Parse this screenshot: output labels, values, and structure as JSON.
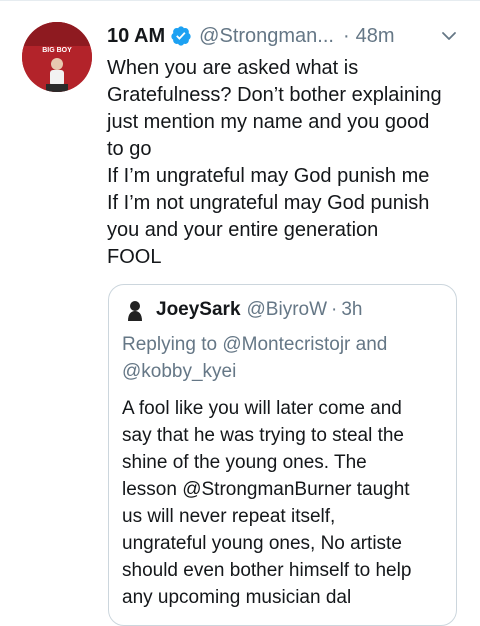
{
  "tweet": {
    "display_name": "10 AM",
    "handle": "@Strongman...",
    "dot": "·",
    "time": "48m",
    "avatar_text": "BIG BOY",
    "lines": [
      "When you are asked what is",
      "Gratefulness? Don’t bother explaining",
      "just mention my name and you good",
      "to go",
      "If I’m ungrateful may God punish me",
      "If I’m not ungrateful may God punish",
      "you and your entire generation",
      "FOOL"
    ]
  },
  "quoted": {
    "display_name": "JoeySark",
    "handle": "@BiyroW",
    "dot": "·",
    "time": "3h",
    "replying_prefix": "Replying to",
    "reply_user_1": "@Montecristojr",
    "reply_and": "and",
    "reply_user_2": "@kobby_kyei",
    "lines": [
      "A fool like you will later come and",
      "say that he was trying to steal the",
      "shine of the young ones. The",
      "lesson @StrongmanBurner taught",
      "us will never repeat itself,",
      "ungrateful young ones, No artiste",
      "should even bother himself to help",
      "any upcoming musician dal"
    ]
  },
  "colors": {
    "text": "#14171a",
    "secondary": "#657786",
    "verified": "#1da1f2",
    "border": "#ccd6dd",
    "avatar_bg": "#b3232a"
  },
  "icons": [
    "verified-badge-icon",
    "chevron-down-icon"
  ]
}
